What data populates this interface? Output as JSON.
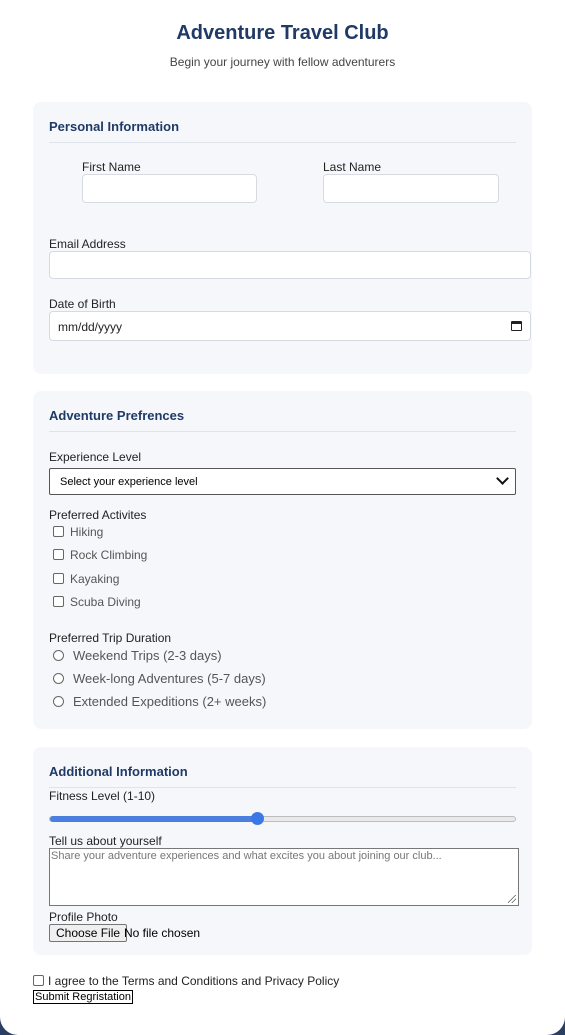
{
  "header": {
    "title": "Adventure Travel Club",
    "subtitle": "Begin your journey with fellow adventurers"
  },
  "personal": {
    "title": "Personal Information",
    "first_name_label": "First Name",
    "last_name_label": "Last Name",
    "email_label": "Email Address",
    "dob_label": "Date of Birth",
    "dob_placeholder": "mm/dd/yyyy"
  },
  "preferences": {
    "title": "Adventure Prefrences",
    "experience_label": "Experience Level",
    "experience_selected": "Select your experience level",
    "activities_label": "Preferred Activites",
    "activities": [
      "Hiking",
      "Rock Climbing",
      "Kayaking",
      "Scuba Diving"
    ],
    "duration_label": "Preferred Trip Duration",
    "durations": [
      "Weekend Trips (2-3 days)",
      "Week-long Adventures (5-7 days)",
      "Extended Expeditions (2+ weeks)"
    ]
  },
  "additional": {
    "title": "Additional Information",
    "fitness_label": "Fitness Level (1-10)",
    "fitness_value": 5,
    "fitness_min": 1,
    "fitness_max": 10,
    "about_label": "Tell us about yourself",
    "about_placeholder": "Share your adventure experiences and what excites you about joining our club...",
    "photo_label": "Profile Photo",
    "choose_file": "Choose File",
    "no_file": "No file chosen"
  },
  "footer": {
    "terms": "I agree to the Terms and Conditions and Privacy Policy",
    "submit": "Submit Regristation"
  },
  "colors": {
    "accent": "#3b78e6",
    "heading": "#1f3a66",
    "section_bg": "#f6f7fb"
  }
}
